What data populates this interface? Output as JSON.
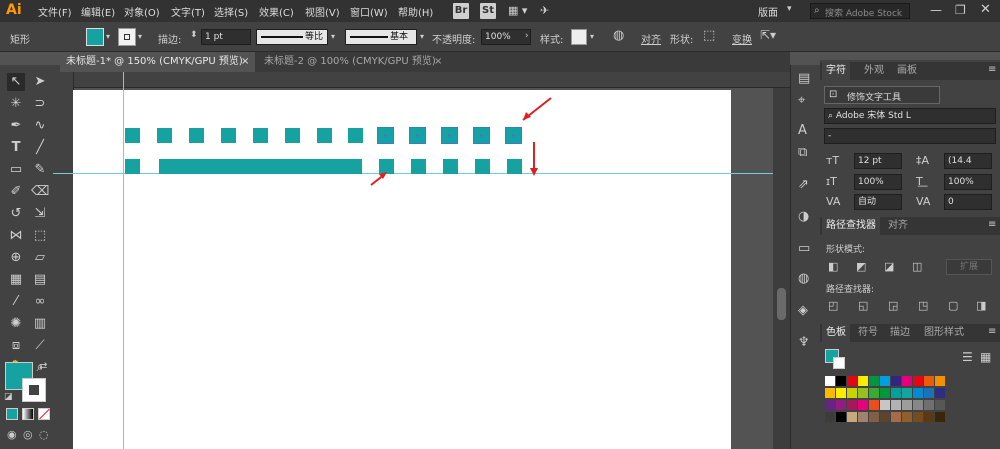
{
  "app": {
    "logo": "Ai",
    "menus": [
      "文件(F)",
      "编辑(E)",
      "对象(O)",
      "文字(T)",
      "选择(S)",
      "效果(C)",
      "视图(V)",
      "窗口(W)",
      "帮助(H)"
    ],
    "bridge_label": "Br",
    "stock_label": "St",
    "workspace": "版面",
    "search_placeholder": "搜索 Adobe Stock"
  },
  "control_bar": {
    "object_type": "矩形",
    "stroke_label": "描边:",
    "stroke_weight": "1 pt",
    "profile_label": "等比",
    "brush_label": "基本",
    "opacity_label": "不透明度:",
    "opacity_value": "100%",
    "style_label": "样式:",
    "align_label": "对齐",
    "shape_label": "形状:",
    "transform_label": "变换",
    "fill_color": "#17a2a2"
  },
  "tabs": [
    {
      "label": "未标题-1* @ 150% (CMYK/GPU 预览)",
      "close": "×"
    },
    {
      "label": "未标题-2 @ 100% (CMYK/GPU 预览)",
      "close": "×"
    }
  ],
  "char_panel": {
    "tabs": [
      "字符",
      "外观",
      "画板"
    ],
    "touch_type": "修饰文字工具",
    "font_family": "Adobe 宋体 Std L",
    "font_style": "-",
    "font_size": "12 pt",
    "leading": "(14.4",
    "vscale": "100%",
    "hscale": "100%",
    "kerning": "自动",
    "tracking": "0"
  },
  "pathfinder": {
    "tabs": [
      "路径查找器",
      "对齐"
    ],
    "shape_modes_label": "形状模式:",
    "expand_label": "扩展",
    "pathfinders_label": "路径查找器:"
  },
  "swatches": {
    "tabs": [
      "色板",
      "符号",
      "描边",
      "图形样式"
    ],
    "row1": [
      "#ffffff",
      "#000000",
      "#e30613",
      "#ffed00",
      "#00963f",
      "#009fe3",
      "#312783",
      "#e5007d",
      "#e30613",
      "#ea5b0c",
      "#f39200"
    ],
    "row2": [
      "#fbba00",
      "#ffed00",
      "#c8d300",
      "#95c11f",
      "#3aaa35",
      "#009640",
      "#00a19a",
      "#17a2a2",
      "#008bd2",
      "#1d71b8",
      "#2d2e83"
    ],
    "row3": [
      "#662483",
      "#951b81",
      "#a3195b",
      "#e6007e",
      "#e94e1b",
      "#c6c6c6",
      "#b2b2b2",
      "#9d9d9c",
      "#878787",
      "#706f6f",
      "#575756"
    ],
    "row4": [
      "#3c3c3b",
      "#000000",
      "#c8a97e",
      "#a0826d",
      "#7f6045",
      "#5d4431",
      "#a76c45",
      "#945d2c",
      "#764b1d",
      "#5a3a14",
      "#3b2509"
    ]
  },
  "artwork": {
    "color": "#17a2a2"
  }
}
